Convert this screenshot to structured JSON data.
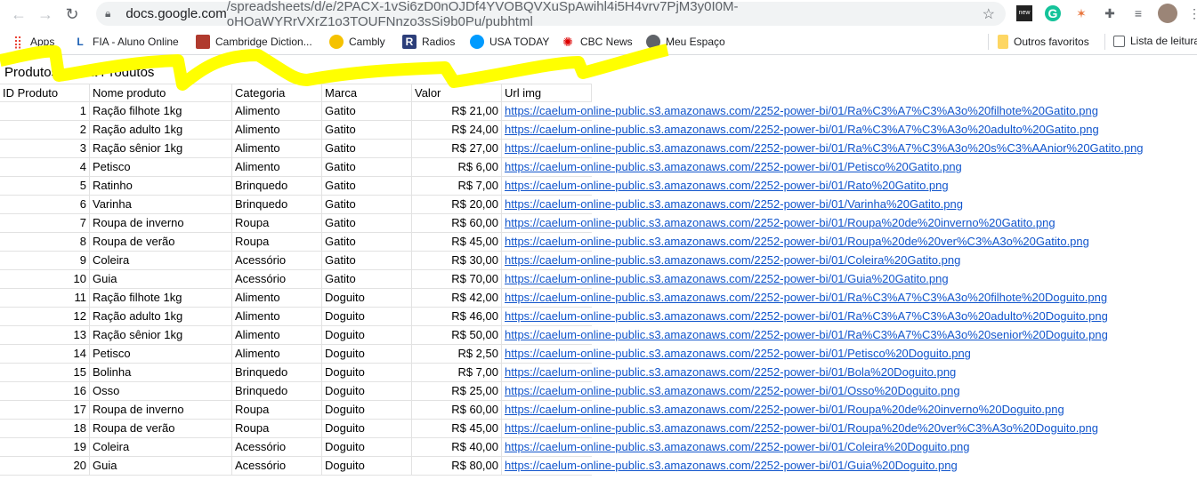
{
  "browser": {
    "url_host": "docs.google.com",
    "url_path": "/spreadsheets/d/e/2PACX-1vSi6zD0nOJDf4YVOBQVXuSpAwihl4i5H4vrv7PjM3y0I0M-oHOaWYRrVXrZ1o3TOUFNnzo3sSi9b0Pu/pubhtml"
  },
  "bookmarks": [
    {
      "label": "Apps",
      "icon": "apps-grid-icon"
    },
    {
      "label": "FIA - Aluno Online",
      "icon": "fia-icon"
    },
    {
      "label": "Cambridge Diction...",
      "icon": "cambridge-icon"
    },
    {
      "label": "Cambly",
      "icon": "cambly-icon"
    },
    {
      "label": "Radios",
      "icon": "radios-icon"
    },
    {
      "label": "USA TODAY",
      "icon": "usa-today-icon"
    },
    {
      "label": "CBC News",
      "icon": "cbc-icon"
    },
    {
      "label": "Meu Espaço",
      "icon": "globe-icon"
    }
  ],
  "bookmarks_right": {
    "other": "Outros favoritos",
    "reading": "Lista de leitura"
  },
  "sheet": {
    "title": "Produtos : Lista Produtos",
    "headers": [
      "ID Produto",
      "Nome produto",
      "Categoria",
      "Marca",
      "Valor",
      "Url img"
    ],
    "rows": [
      [
        "1",
        "Ração filhote 1kg",
        "Alimento",
        "Gatito",
        "R$ 21,00",
        "https://caelum-online-public.s3.amazonaws.com/2252-power-bi/01/Ra%C3%A7%C3%A3o%20filhote%20Gatito.png"
      ],
      [
        "2",
        "Ração adulto 1kg",
        "Alimento",
        "Gatito",
        "R$ 24,00",
        "https://caelum-online-public.s3.amazonaws.com/2252-power-bi/01/Ra%C3%A7%C3%A3o%20adulto%20Gatito.png"
      ],
      [
        "3",
        "Ração sênior 1kg",
        "Alimento",
        "Gatito",
        "R$ 27,00",
        "https://caelum-online-public.s3.amazonaws.com/2252-power-bi/01/Ra%C3%A7%C3%A3o%20s%C3%AAnior%20Gatito.png"
      ],
      [
        "4",
        "Petisco",
        "Alimento",
        "Gatito",
        "R$ 6,00",
        "https://caelum-online-public.s3.amazonaws.com/2252-power-bi/01/Petisco%20Gatito.png"
      ],
      [
        "5",
        "Ratinho",
        "Brinquedo",
        "Gatito",
        "R$ 7,00",
        "https://caelum-online-public.s3.amazonaws.com/2252-power-bi/01/Rato%20Gatito.png"
      ],
      [
        "6",
        "Varinha",
        "Brinquedo",
        "Gatito",
        "R$ 20,00",
        "https://caelum-online-public.s3.amazonaws.com/2252-power-bi/01/Varinha%20Gatito.png"
      ],
      [
        "7",
        "Roupa de inverno",
        "Roupa",
        "Gatito",
        "R$ 60,00",
        "https://caelum-online-public.s3.amazonaws.com/2252-power-bi/01/Roupa%20de%20inverno%20Gatito.png"
      ],
      [
        "8",
        "Roupa de verão",
        "Roupa",
        "Gatito",
        "R$ 45,00",
        "https://caelum-online-public.s3.amazonaws.com/2252-power-bi/01/Roupa%20de%20ver%C3%A3o%20Gatito.png"
      ],
      [
        "9",
        "Coleira",
        "Acessório",
        "Gatito",
        "R$ 30,00",
        "https://caelum-online-public.s3.amazonaws.com/2252-power-bi/01/Coleira%20Gatito.png"
      ],
      [
        "10",
        "Guia",
        "Acessório",
        "Gatito",
        "R$ 70,00",
        "https://caelum-online-public.s3.amazonaws.com/2252-power-bi/01/Guia%20Gatito.png"
      ],
      [
        "11",
        "Ração filhote 1kg",
        "Alimento",
        "Doguito",
        "R$ 42,00",
        "https://caelum-online-public.s3.amazonaws.com/2252-power-bi/01/Ra%C3%A7%C3%A3o%20filhote%20Doguito.png"
      ],
      [
        "12",
        "Ração adulto 1kg",
        "Alimento",
        "Doguito",
        "R$ 46,00",
        "https://caelum-online-public.s3.amazonaws.com/2252-power-bi/01/Ra%C3%A7%C3%A3o%20adulto%20Doguito.png"
      ],
      [
        "13",
        "Ração sênior 1kg",
        "Alimento",
        "Doguito",
        "R$ 50,00",
        "https://caelum-online-public.s3.amazonaws.com/2252-power-bi/01/Ra%C3%A7%C3%A3o%20senior%20Doguito.png"
      ],
      [
        "14",
        "Petisco",
        "Alimento",
        "Doguito",
        "R$ 2,50",
        "https://caelum-online-public.s3.amazonaws.com/2252-power-bi/01/Petisco%20Doguito.png"
      ],
      [
        "15",
        "Bolinha",
        "Brinquedo",
        "Doguito",
        "R$ 7,00",
        "https://caelum-online-public.s3.amazonaws.com/2252-power-bi/01/Bola%20Doguito.png"
      ],
      [
        "16",
        "Osso",
        "Brinquedo",
        "Doguito",
        "R$ 25,00",
        "https://caelum-online-public.s3.amazonaws.com/2252-power-bi/01/Osso%20Doguito.png"
      ],
      [
        "17",
        "Roupa de inverno",
        "Roupa",
        "Doguito",
        "R$ 60,00",
        "https://caelum-online-public.s3.amazonaws.com/2252-power-bi/01/Roupa%20de%20inverno%20Doguito.png"
      ],
      [
        "18",
        "Roupa de verão",
        "Roupa",
        "Doguito",
        "R$ 45,00",
        "https://caelum-online-public.s3.amazonaws.com/2252-power-bi/01/Roupa%20de%20ver%C3%A3o%20Doguito.png"
      ],
      [
        "19",
        "Coleira",
        "Acessório",
        "Doguito",
        "R$ 40,00",
        "https://caelum-online-public.s3.amazonaws.com/2252-power-bi/01/Coleira%20Doguito.png"
      ],
      [
        "20",
        "Guia",
        "Acessório",
        "Doguito",
        "R$ 80,00",
        "https://caelum-online-public.s3.amazonaws.com/2252-power-bi/01/Guia%20Doguito.png"
      ]
    ]
  },
  "colors": {
    "link": "#1155cc",
    "highlight": "#ffff00",
    "omnibox": "#f1f3f4"
  }
}
